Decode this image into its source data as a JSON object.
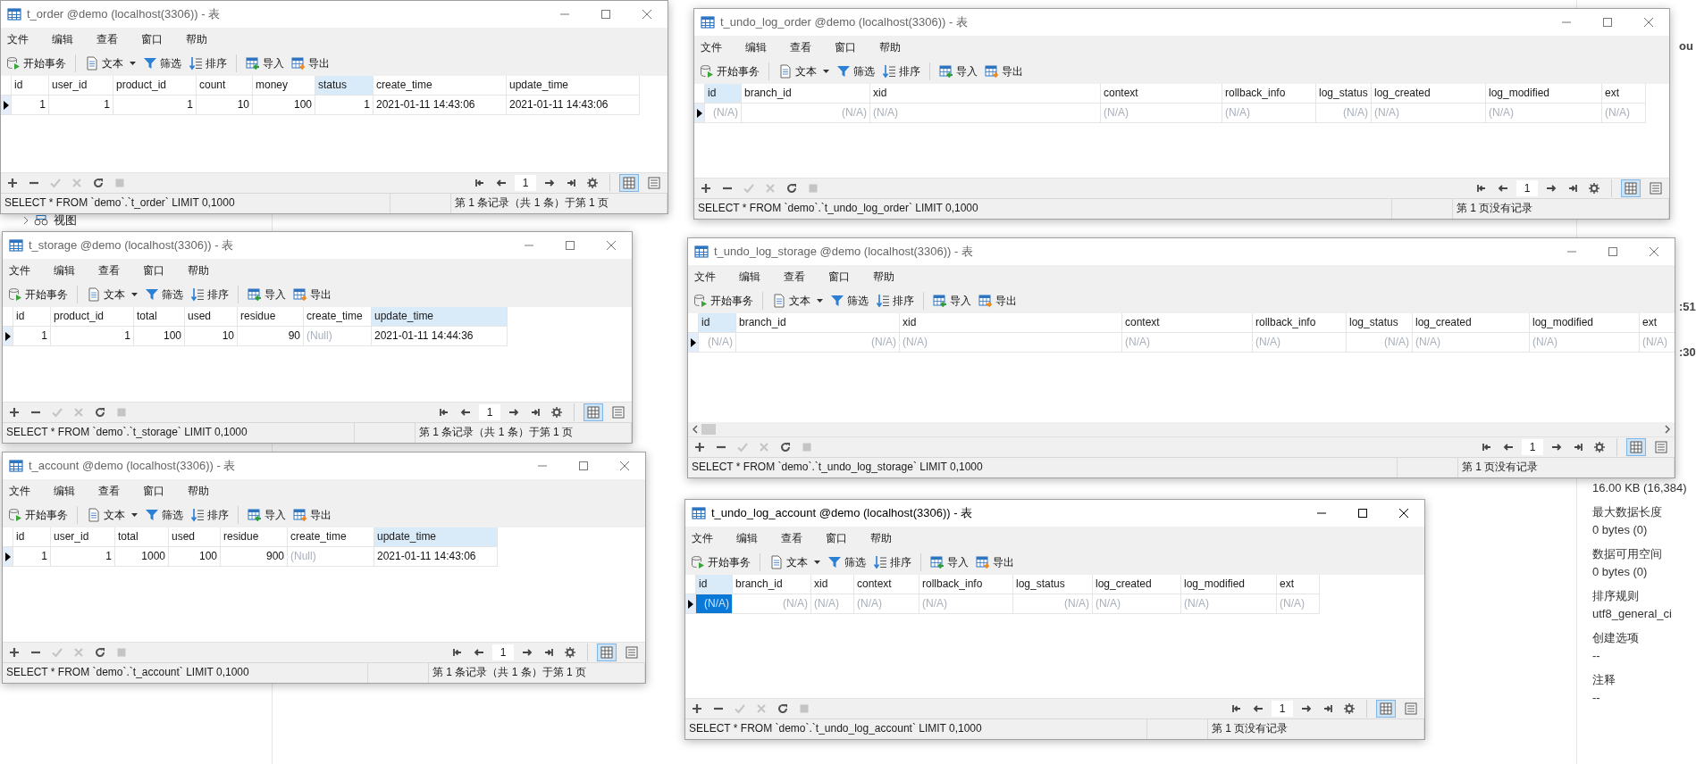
{
  "background": {
    "tree_item": {
      "label": "视图"
    },
    "side_fragments": [
      "ou",
      ":51",
      ":30"
    ],
    "info": [
      {
        "value": "16.00 KB (16,384)"
      },
      {
        "label": "最大数据长度",
        "value": "0 bytes (0)"
      },
      {
        "label": "数据可用空间",
        "value": "0 bytes (0)"
      },
      {
        "label": "排序规则",
        "value": "utf8_general_ci"
      },
      {
        "label": "创建选项",
        "value": "--"
      },
      {
        "label": "注释",
        "value": "--"
      }
    ]
  },
  "windows": [
    {
      "title": "t_order @demo (localhost(3306)) - 表",
      "active": false,
      "menu": [
        "文件",
        "编辑",
        "查看",
        "窗口",
        "帮助"
      ],
      "toolbar": [
        {
          "kind": "transaction",
          "label": "开始事务"
        },
        {
          "kind": "text",
          "label": "文本"
        },
        {
          "kind": "filter",
          "label": "筛选"
        },
        {
          "kind": "sort",
          "label": "排序"
        },
        {
          "kind": "import",
          "label": "导入"
        },
        {
          "kind": "export",
          "label": "导出"
        }
      ],
      "columns": [
        {
          "name": "id",
          "selected": false
        },
        {
          "name": "user_id",
          "selected": false
        },
        {
          "name": "product_id",
          "selected": false
        },
        {
          "name": "count",
          "selected": false
        },
        {
          "name": "money",
          "selected": false
        },
        {
          "name": "status",
          "selected": true
        },
        {
          "name": "create_time",
          "selected": false
        },
        {
          "name": "update_time",
          "selected": false
        }
      ],
      "rows": [
        {
          "current": true,
          "cells": [
            {
              "text": "1",
              "kind": "number",
              "null": false,
              "selected": false
            },
            {
              "text": "1",
              "kind": "number",
              "null": false,
              "selected": false
            },
            {
              "text": "1",
              "kind": "number",
              "null": false,
              "selected": false
            },
            {
              "text": "10",
              "kind": "number",
              "null": false,
              "selected": false
            },
            {
              "text": "100",
              "kind": "number",
              "null": false,
              "selected": false
            },
            {
              "text": "1",
              "kind": "number",
              "null": false,
              "selected": false
            },
            {
              "text": "2021-01-11 14:43:06",
              "kind": "text",
              "null": false,
              "selected": false
            },
            {
              "text": "2021-01-11 14:43:06",
              "kind": "text",
              "null": false,
              "selected": false
            }
          ]
        }
      ],
      "bottom_tools": [
        {
          "kind": "add",
          "disabled": false
        },
        {
          "kind": "delete",
          "disabled": false
        },
        {
          "kind": "apply",
          "disabled": true
        },
        {
          "kind": "discard",
          "disabled": true
        },
        {
          "kind": "refresh",
          "disabled": false
        },
        {
          "kind": "stop",
          "disabled": true
        }
      ],
      "page": "1",
      "views": [
        {
          "kind": "grid",
          "selected": true
        },
        {
          "kind": "form",
          "selected": false
        }
      ],
      "status": {
        "sql": "SELECT * FROM `demo`.`t_order` LIMIT 0,1000",
        "records": "第 1 条记录（共 1 条）于第 1 页"
      }
    },
    {
      "title": "t_undo_log_order @demo (localhost(3306)) - 表",
      "active": false,
      "menu": [
        "文件",
        "编辑",
        "查看",
        "窗口",
        "帮助"
      ],
      "toolbar": [
        {
          "kind": "transaction",
          "label": "开始事务"
        },
        {
          "kind": "text",
          "label": "文本"
        },
        {
          "kind": "filter",
          "label": "筛选"
        },
        {
          "kind": "sort",
          "label": "排序"
        },
        {
          "kind": "import",
          "label": "导入"
        },
        {
          "kind": "export",
          "label": "导出"
        }
      ],
      "columns": [
        {
          "name": "id",
          "selected": true
        },
        {
          "name": "branch_id",
          "selected": false
        },
        {
          "name": "xid",
          "selected": false
        },
        {
          "name": "context",
          "selected": false
        },
        {
          "name": "rollback_info",
          "selected": false
        },
        {
          "name": "log_status",
          "selected": false
        },
        {
          "name": "log_created",
          "selected": false
        },
        {
          "name": "log_modified",
          "selected": false
        },
        {
          "name": "ext",
          "selected": false
        }
      ],
      "rows": [
        {
          "current": true,
          "cells": [
            {
              "text": "(N/A)",
              "kind": "number",
              "null": true,
              "selected": false
            },
            {
              "text": "(N/A)",
              "kind": "number",
              "null": true,
              "selected": false
            },
            {
              "text": "(N/A)",
              "kind": "text",
              "null": true,
              "selected": false
            },
            {
              "text": "(N/A)",
              "kind": "text",
              "null": true,
              "selected": false
            },
            {
              "text": "(N/A)",
              "kind": "text",
              "null": true,
              "selected": false
            },
            {
              "text": "(N/A)",
              "kind": "number",
              "null": true,
              "selected": false
            },
            {
              "text": "(N/A)",
              "kind": "text",
              "null": true,
              "selected": false
            },
            {
              "text": "(N/A)",
              "kind": "text",
              "null": true,
              "selected": false
            },
            {
              "text": "(N/A)",
              "kind": "text",
              "null": true,
              "selected": false
            }
          ]
        }
      ],
      "bottom_tools": [
        {
          "kind": "add",
          "disabled": false
        },
        {
          "kind": "delete",
          "disabled": false
        },
        {
          "kind": "apply",
          "disabled": true
        },
        {
          "kind": "discard",
          "disabled": true
        },
        {
          "kind": "refresh",
          "disabled": false
        },
        {
          "kind": "stop",
          "disabled": true
        }
      ],
      "page": "1",
      "views": [
        {
          "kind": "grid",
          "selected": true
        },
        {
          "kind": "form",
          "selected": false
        }
      ],
      "status": {
        "sql": "SELECT * FROM `demo`.`t_undo_log_order` LIMIT 0,1000",
        "records": "第 1 页没有记录"
      }
    },
    {
      "title": "t_storage @demo (localhost(3306)) - 表",
      "active": false,
      "menu": [
        "文件",
        "编辑",
        "查看",
        "窗口",
        "帮助"
      ],
      "toolbar": [
        {
          "kind": "transaction",
          "label": "开始事务"
        },
        {
          "kind": "text",
          "label": "文本"
        },
        {
          "kind": "filter",
          "label": "筛选"
        },
        {
          "kind": "sort",
          "label": "排序"
        },
        {
          "kind": "import",
          "label": "导入"
        },
        {
          "kind": "export",
          "label": "导出"
        }
      ],
      "columns": [
        {
          "name": "id",
          "selected": false
        },
        {
          "name": "product_id",
          "selected": false
        },
        {
          "name": "total",
          "selected": false
        },
        {
          "name": "used",
          "selected": false
        },
        {
          "name": "residue",
          "selected": false
        },
        {
          "name": "create_time",
          "selected": false
        },
        {
          "name": "update_time",
          "selected": true
        }
      ],
      "rows": [
        {
          "current": true,
          "cells": [
            {
              "text": "1",
              "kind": "number",
              "null": false,
              "selected": false
            },
            {
              "text": "1",
              "kind": "number",
              "null": false,
              "selected": false
            },
            {
              "text": "100",
              "kind": "number",
              "null": false,
              "selected": false
            },
            {
              "text": "10",
              "kind": "number",
              "null": false,
              "selected": false
            },
            {
              "text": "90",
              "kind": "number",
              "null": false,
              "selected": false
            },
            {
              "text": "(Null)",
              "kind": "text",
              "null": true,
              "selected": false
            },
            {
              "text": "2021-01-11 14:44:36",
              "kind": "text",
              "null": false,
              "selected": false
            }
          ]
        }
      ],
      "bottom_tools": [
        {
          "kind": "add",
          "disabled": false
        },
        {
          "kind": "delete",
          "disabled": false
        },
        {
          "kind": "apply",
          "disabled": true
        },
        {
          "kind": "discard",
          "disabled": true
        },
        {
          "kind": "refresh",
          "disabled": false
        },
        {
          "kind": "stop",
          "disabled": true
        }
      ],
      "page": "1",
      "views": [
        {
          "kind": "grid",
          "selected": true
        },
        {
          "kind": "form",
          "selected": false
        }
      ],
      "status": {
        "sql": "SELECT * FROM `demo`.`t_storage` LIMIT 0,1000",
        "records": "第 1 条记录（共 1 条）于第 1 页"
      }
    },
    {
      "title": "t_undo_log_storage @demo (localhost(3306)) - 表",
      "active": false,
      "horizontal_scrollbar": true,
      "menu": [
        "文件",
        "编辑",
        "查看",
        "窗口",
        "帮助"
      ],
      "toolbar": [
        {
          "kind": "transaction",
          "label": "开始事务"
        },
        {
          "kind": "text",
          "label": "文本"
        },
        {
          "kind": "filter",
          "label": "筛选"
        },
        {
          "kind": "sort",
          "label": "排序"
        },
        {
          "kind": "import",
          "label": "导入"
        },
        {
          "kind": "export",
          "label": "导出"
        }
      ],
      "columns": [
        {
          "name": "id",
          "selected": true
        },
        {
          "name": "branch_id",
          "selected": false
        },
        {
          "name": "xid",
          "selected": false
        },
        {
          "name": "context",
          "selected": false
        },
        {
          "name": "rollback_info",
          "selected": false
        },
        {
          "name": "log_status",
          "selected": false
        },
        {
          "name": "log_created",
          "selected": false
        },
        {
          "name": "log_modified",
          "selected": false
        },
        {
          "name": "ext",
          "selected": false
        }
      ],
      "rows": [
        {
          "current": true,
          "cells": [
            {
              "text": "(N/A)",
              "kind": "number",
              "null": true,
              "selected": false
            },
            {
              "text": "(N/A)",
              "kind": "number",
              "null": true,
              "selected": false
            },
            {
              "text": "(N/A)",
              "kind": "text",
              "null": true,
              "selected": false
            },
            {
              "text": "(N/A)",
              "kind": "text",
              "null": true,
              "selected": false
            },
            {
              "text": "(N/A)",
              "kind": "text",
              "null": true,
              "selected": false
            },
            {
              "text": "(N/A)",
              "kind": "number",
              "null": true,
              "selected": false
            },
            {
              "text": "(N/A)",
              "kind": "text",
              "null": true,
              "selected": false
            },
            {
              "text": "(N/A)",
              "kind": "text",
              "null": true,
              "selected": false
            },
            {
              "text": "(N/A)",
              "kind": "text",
              "null": true,
              "selected": false
            }
          ]
        }
      ],
      "bottom_tools": [
        {
          "kind": "add",
          "disabled": false
        },
        {
          "kind": "delete",
          "disabled": false
        },
        {
          "kind": "apply",
          "disabled": true
        },
        {
          "kind": "discard",
          "disabled": true
        },
        {
          "kind": "refresh",
          "disabled": false
        },
        {
          "kind": "stop",
          "disabled": true
        }
      ],
      "page": "1",
      "views": [
        {
          "kind": "grid",
          "selected": true
        },
        {
          "kind": "form",
          "selected": false
        }
      ],
      "status": {
        "sql": "SELECT * FROM `demo`.`t_undo_log_storage` LIMIT 0,1000",
        "records": "第 1 页没有记录"
      }
    },
    {
      "title": "t_account @demo (localhost(3306)) - 表",
      "active": false,
      "menu": [
        "文件",
        "编辑",
        "查看",
        "窗口",
        "帮助"
      ],
      "toolbar": [
        {
          "kind": "transaction",
          "label": "开始事务"
        },
        {
          "kind": "text",
          "label": "文本"
        },
        {
          "kind": "filter",
          "label": "筛选"
        },
        {
          "kind": "sort",
          "label": "排序"
        },
        {
          "kind": "import",
          "label": "导入"
        },
        {
          "kind": "export",
          "label": "导出"
        }
      ],
      "columns": [
        {
          "name": "id",
          "selected": false
        },
        {
          "name": "user_id",
          "selected": false
        },
        {
          "name": "total",
          "selected": false
        },
        {
          "name": "used",
          "selected": false
        },
        {
          "name": "residue",
          "selected": false
        },
        {
          "name": "create_time",
          "selected": false
        },
        {
          "name": "update_time",
          "selected": true
        }
      ],
      "rows": [
        {
          "current": true,
          "cells": [
            {
              "text": "1",
              "kind": "number",
              "null": false,
              "selected": false
            },
            {
              "text": "1",
              "kind": "number",
              "null": false,
              "selected": false
            },
            {
              "text": "1000",
              "kind": "number",
              "null": false,
              "selected": false
            },
            {
              "text": "100",
              "kind": "number",
              "null": false,
              "selected": false
            },
            {
              "text": "900",
              "kind": "number",
              "null": false,
              "selected": false
            },
            {
              "text": "(Null)",
              "kind": "text",
              "null": true,
              "selected": false
            },
            {
              "text": "2021-01-11 14:43:06",
              "kind": "text",
              "null": false,
              "selected": false
            }
          ]
        }
      ],
      "bottom_tools": [
        {
          "kind": "add",
          "disabled": false
        },
        {
          "kind": "delete",
          "disabled": false
        },
        {
          "kind": "apply",
          "disabled": true
        },
        {
          "kind": "discard",
          "disabled": true
        },
        {
          "kind": "refresh",
          "disabled": false
        },
        {
          "kind": "stop",
          "disabled": true
        }
      ],
      "page": "1",
      "views": [
        {
          "kind": "grid",
          "selected": true
        },
        {
          "kind": "form",
          "selected": false
        }
      ],
      "status": {
        "sql": "SELECT * FROM `demo`.`t_account` LIMIT 0,1000",
        "records": "第 1 条记录（共 1 条）于第 1 页"
      }
    },
    {
      "title": "t_undo_log_account @demo (localhost(3306)) - 表",
      "active": true,
      "menu": [
        "文件",
        "编辑",
        "查看",
        "窗口",
        "帮助"
      ],
      "toolbar": [
        {
          "kind": "transaction",
          "label": "开始事务"
        },
        {
          "kind": "text",
          "label": "文本"
        },
        {
          "kind": "filter",
          "label": "筛选"
        },
        {
          "kind": "sort",
          "label": "排序"
        },
        {
          "kind": "import",
          "label": "导入"
        },
        {
          "kind": "export",
          "label": "导出"
        }
      ],
      "columns": [
        {
          "name": "id",
          "selected": true
        },
        {
          "name": "branch_id",
          "selected": false
        },
        {
          "name": "xid",
          "selected": false
        },
        {
          "name": "context",
          "selected": false
        },
        {
          "name": "rollback_info",
          "selected": false
        },
        {
          "name": "log_status",
          "selected": false
        },
        {
          "name": "log_created",
          "selected": false
        },
        {
          "name": "log_modified",
          "selected": false
        },
        {
          "name": "ext",
          "selected": false
        }
      ],
      "rows": [
        {
          "current": true,
          "cells": [
            {
              "text": "(N/A)",
              "kind": "number",
              "null": true,
              "selected": true
            },
            {
              "text": "(N/A)",
              "kind": "number",
              "null": true,
              "selected": false
            },
            {
              "text": "(N/A)",
              "kind": "text",
              "null": true,
              "selected": false
            },
            {
              "text": "(N/A)",
              "kind": "text",
              "null": true,
              "selected": false
            },
            {
              "text": "(N/A)",
              "kind": "text",
              "null": true,
              "selected": false
            },
            {
              "text": "(N/A)",
              "kind": "number",
              "null": true,
              "selected": false
            },
            {
              "text": "(N/A)",
              "kind": "text",
              "null": true,
              "selected": false
            },
            {
              "text": "(N/A)",
              "kind": "text",
              "null": true,
              "selected": false
            },
            {
              "text": "(N/A)",
              "kind": "text",
              "null": true,
              "selected": false
            }
          ]
        }
      ],
      "bottom_tools": [
        {
          "kind": "add",
          "disabled": false
        },
        {
          "kind": "delete",
          "disabled": false
        },
        {
          "kind": "apply",
          "disabled": true
        },
        {
          "kind": "discard",
          "disabled": true
        },
        {
          "kind": "refresh",
          "disabled": false
        },
        {
          "kind": "stop",
          "disabled": true
        }
      ],
      "page": "1",
      "views": [
        {
          "kind": "grid",
          "selected": true
        },
        {
          "kind": "form",
          "selected": false
        }
      ],
      "status": {
        "sql": "SELECT * FROM `demo`.`t_undo_log_account` LIMIT 0,1000",
        "records": "第 1 页没有记录"
      }
    }
  ]
}
